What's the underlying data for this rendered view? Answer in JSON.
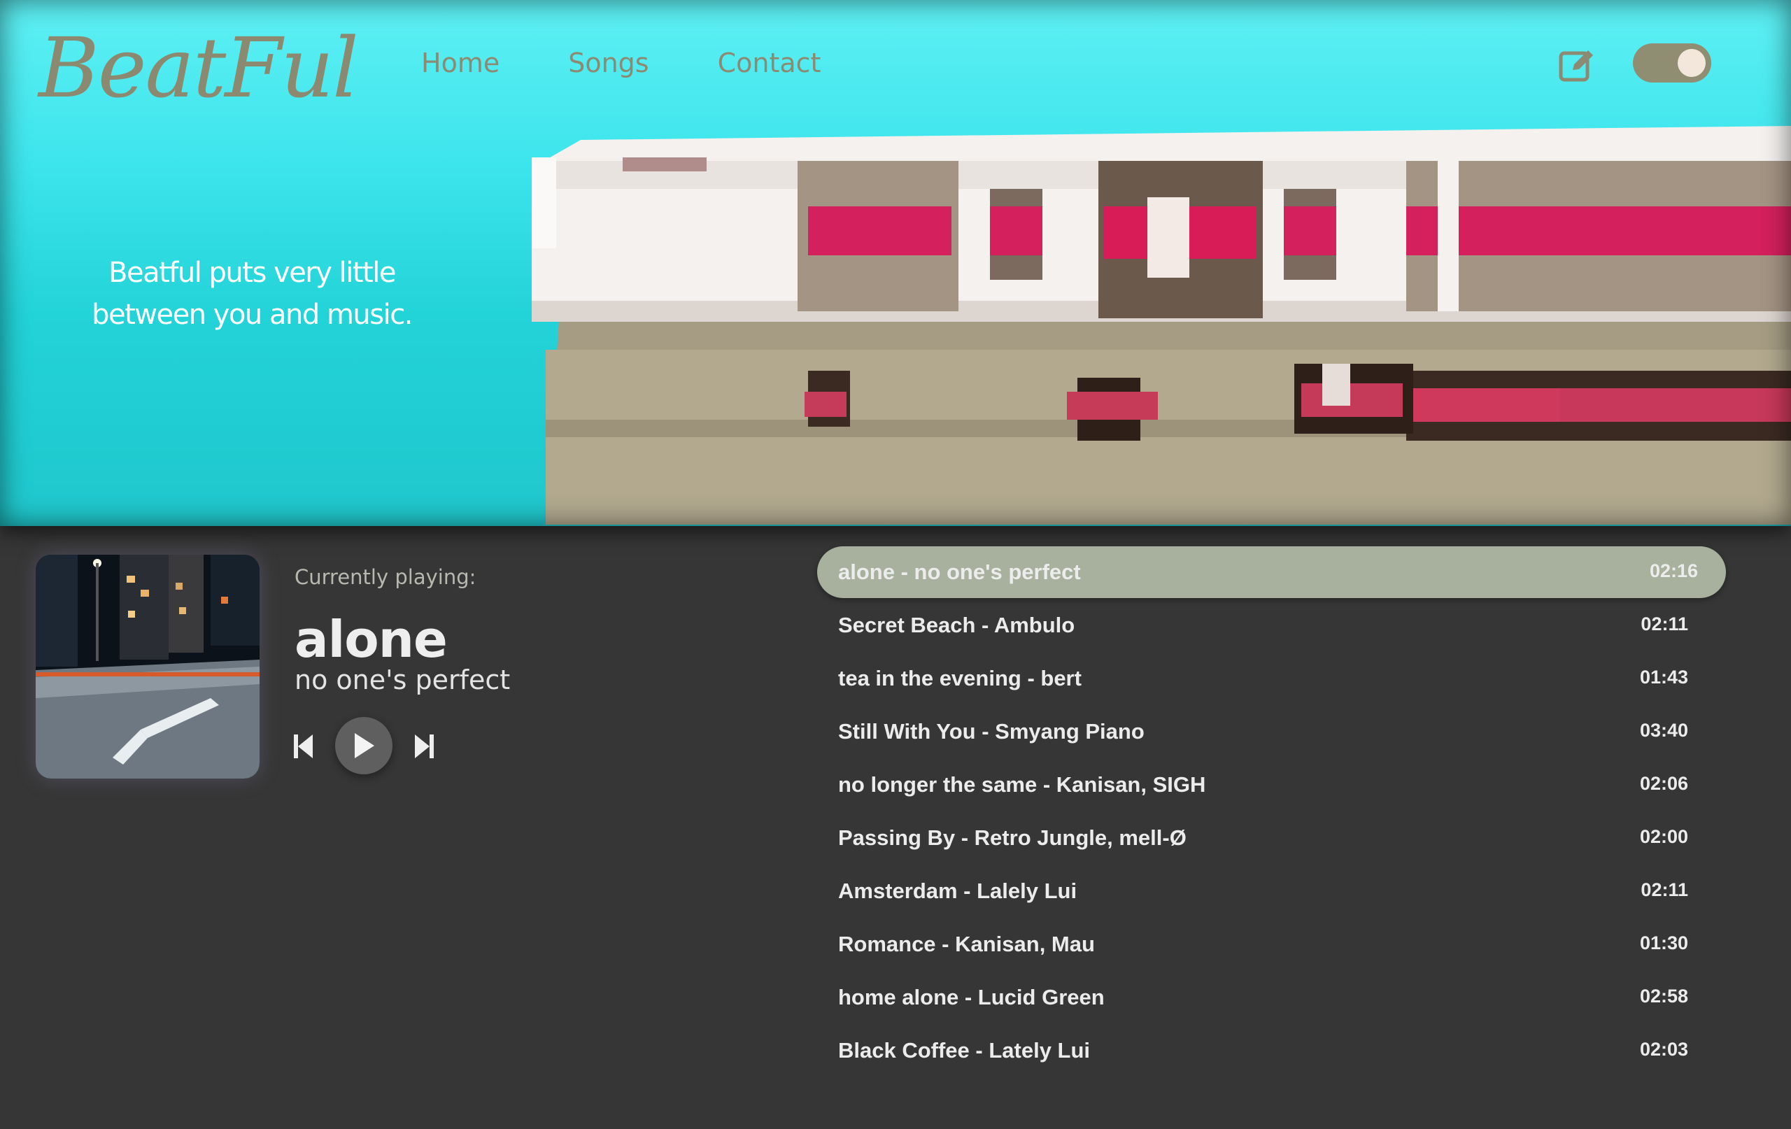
{
  "brand": {
    "logo": "BeatFul"
  },
  "nav": {
    "items": [
      "Home",
      "Songs",
      "Contact"
    ]
  },
  "header_icons": {
    "edit": "edit-icon",
    "theme_toggle": "toggle-switch"
  },
  "hero": {
    "tagline_line1": "Beatful puts very little",
    "tagline_line2": "between you and music."
  },
  "player": {
    "label": "Currently playing:",
    "title": "alone",
    "artist": "no one's perfect",
    "controls": [
      "skip-back-icon",
      "play-icon",
      "skip-forward-icon"
    ]
  },
  "playlist": [
    {
      "name": "alone - no one's perfect",
      "time": "02:16",
      "active": true
    },
    {
      "name": "Secret Beach - Ambulo",
      "time": "02:11"
    },
    {
      "name": "tea in the evening - bert",
      "time": "01:43"
    },
    {
      "name": "Still With You - Smyang Piano",
      "time": "03:40"
    },
    {
      "name": "no longer the same - Kanisan, SIGH",
      "time": "02:06"
    },
    {
      "name": "Passing By - Retro Jungle, mell-Ø",
      "time": "02:00"
    },
    {
      "name": "Amsterdam - Lalely Lui",
      "time": "02:11"
    },
    {
      "name": "Romance - Kanisan, Mau",
      "time": "01:30"
    },
    {
      "name": "home alone - Lucid Green",
      "time": "02:58"
    },
    {
      "name": "Black Coffee - Lately Lui",
      "time": "02:03"
    }
  ],
  "colors": {
    "background": "#363636",
    "accent": "#a7b19e",
    "hero_cyan": "#3ee5ec",
    "nav_text": "#8c8a72"
  }
}
